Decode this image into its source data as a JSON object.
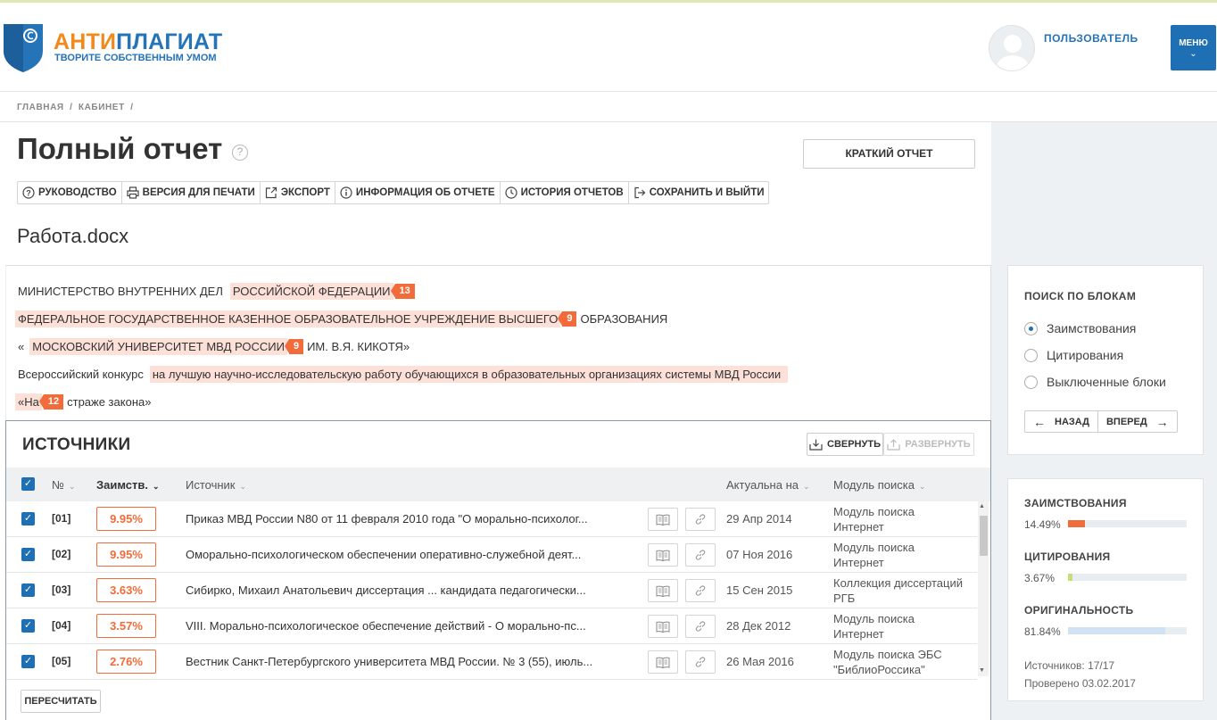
{
  "header": {
    "logo_part1": "АНТИ",
    "logo_part2": "ПЛАГИАТ",
    "logo_tagline": "ТВОРИТЕ СОБСТВЕННЫМ УМОМ",
    "user_name": "ПОЛЬЗОВАТЕЛЬ",
    "menu_label": "МЕНЮ",
    "brand_orange": "#f08a1c",
    "brand_blue": "#2574b8"
  },
  "breadcrumb": [
    "ГЛАВНАЯ",
    "/",
    "КАБИНЕТ",
    "/"
  ],
  "page": {
    "title": "Полный отчет",
    "help": "?",
    "short_report": "КРАТКИЙ ОТЧЕТ",
    "filename": "Работа.docx"
  },
  "toolbar": {
    "guide": "РУКОВОДСТВО",
    "print": "ВЕРСИЯ ДЛЯ ПЕЧАТИ",
    "export": "ЭКСПОРТ",
    "info": "ИНФОРМАЦИЯ ОБ ОТЧЕТЕ",
    "history": "ИСТОРИЯ ОТЧЕТОВ",
    "save_exit": "СОХРАНИТЬ И ВЫЙТИ"
  },
  "document": {
    "l1_plain": "МИНИСТЕРСТВО ВНУТРЕННИХ ДЕЛ",
    "l1_hl": "РОССИЙСКОЙ ФЕДЕРАЦИИ",
    "l1_badge": "13",
    "l2_hl": "ФЕДЕРАЛЬНОЕ ГОСУДАРСТВЕННОЕ КАЗЕННОЕ ОБРАЗОВАТЕЛЬНОЕ УЧРЕЖДЕНИЕ ВЫСШЕГО",
    "l2_badge": "9",
    "l2_plain": "ОБРАЗОВАНИЯ",
    "l3_pre": "«",
    "l3_hl": "МОСКОВСКИЙ УНИВЕРСИТЕТ МВД РОССИИ",
    "l3_badge": "9",
    "l3_plain": "ИМ. В.Я. КИКОТЯ»",
    "l4_plain": "Всероссийский конкурс",
    "l4_hl": "на лучшую научно-исследовательскую работу обучающихся в образовательных организациях системы МВД России",
    "l5_hl": "«На",
    "l5_badge": "12",
    "l5_plain": "страже закона»"
  },
  "sources": {
    "title": "ИСТОЧНИКИ",
    "collapse": "СВЕРНУТЬ",
    "expand": "РАЗВЕРНУТЬ",
    "recalc": "ПЕРЕСЧИТАТЬ",
    "columns": {
      "num": "№",
      "borrow": "Заимств.",
      "source": "Источник",
      "actual": "Актуальна на",
      "module": "Модуль поиска"
    },
    "rows": [
      {
        "num": "[01]",
        "pct": "9.95%",
        "source": "Приказ МВД России N80 от 11 февраля 2010 года \"О морально-психолог...",
        "date": "29 Апр 2014",
        "module1": "Модуль поиска",
        "module2": "Интернет"
      },
      {
        "num": "[02]",
        "pct": "9.95%",
        "source": "Оморально-психологическом обеспечении оперативно-служебной деят...",
        "date": "07 Ноя 2016",
        "module1": "Модуль поиска",
        "module2": "Интернет"
      },
      {
        "num": "[03]",
        "pct": "3.63%",
        "source": "Сибирко, Михаил Анатольевич диссертация ... кандидата педагогически...",
        "date": "15 Сен 2015",
        "module1": "Коллекция диссертаций",
        "module2": "РГБ"
      },
      {
        "num": "[04]",
        "pct": "3.57%",
        "source": "VIII. Морально-психологическое обеспечение действий - О морально-пс...",
        "date": "28 Дек 2012",
        "module1": "Модуль поиска",
        "module2": "Интернет"
      },
      {
        "num": "[05]",
        "pct": "2.76%",
        "source": "Вестник Санкт-Петербургского университета МВД России. № 3 (55), июль...",
        "date": "26 Мая 2016",
        "module1": "Модуль поиска ЭБС",
        "module2": "\"БиблиоРоссика\""
      }
    ]
  },
  "block_search": {
    "title": "ПОИСК ПО БЛОКАМ",
    "opt1": "Заимствования",
    "opt2": "Цитирования",
    "opt3": "Выключенные блоки",
    "selected": "Заимствования",
    "back": "НАЗАД",
    "forward": "ВПЕРЕД"
  },
  "stats": {
    "borrow_label": "ЗАИМСТВОВАНИЯ",
    "borrow_val": "14.49%",
    "borrow_pct": 14.49,
    "borrow_color": "#f26b3a",
    "cite_label": "ЦИТИРОВАНИЯ",
    "cite_val": "3.67%",
    "cite_pct": 3.67,
    "cite_color": "#c5e07a",
    "orig_label": "ОРИГИНАЛЬНОСТЬ",
    "orig_val": "81.84%",
    "orig_pct": 81.84,
    "orig_color": "#cfe3f5",
    "sources_count": "Источников: 17/17",
    "checked": "Проверено 03.02.2017"
  }
}
